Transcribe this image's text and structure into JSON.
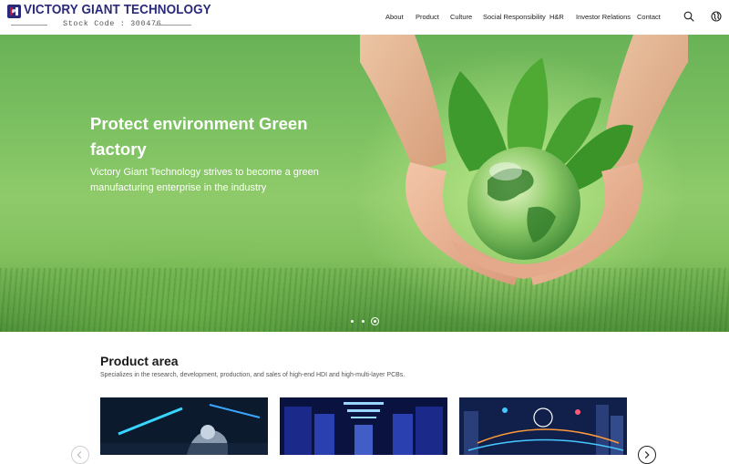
{
  "header": {
    "company_name": "VICTORY GIANT TECHNOLOGY",
    "stock_code": "Stock Code : 300476",
    "brand_colors": {
      "primary": "#2a2a7a",
      "accent": "#c8102e"
    },
    "nav": [
      {
        "label": "About"
      },
      {
        "label": "Product"
      },
      {
        "label": "Culture"
      },
      {
        "label": "Social Responsibility"
      },
      {
        "label": "H&R"
      },
      {
        "label": "Investor Relations"
      },
      {
        "label": "Contact"
      }
    ],
    "icons": {
      "search": "search-icon",
      "language": "globe-icon"
    }
  },
  "hero": {
    "title": "Protect environment Green factory",
    "subtitle": "Victory Giant Technology strives to become a green manufacturing enterprise in the industry",
    "slide_count": 3,
    "active_slide": 3
  },
  "products": {
    "title": "Product area",
    "description": "Specializes in the research, development, production, and sales of high-end HDI and high-multi-layer PCBs.",
    "cards": [
      {
        "image": "robot-arm-image"
      },
      {
        "image": "server-room-image"
      },
      {
        "image": "smart-city-image"
      }
    ],
    "icons": {
      "prev": "chevron-left-icon",
      "next": "chevron-right-icon"
    }
  }
}
